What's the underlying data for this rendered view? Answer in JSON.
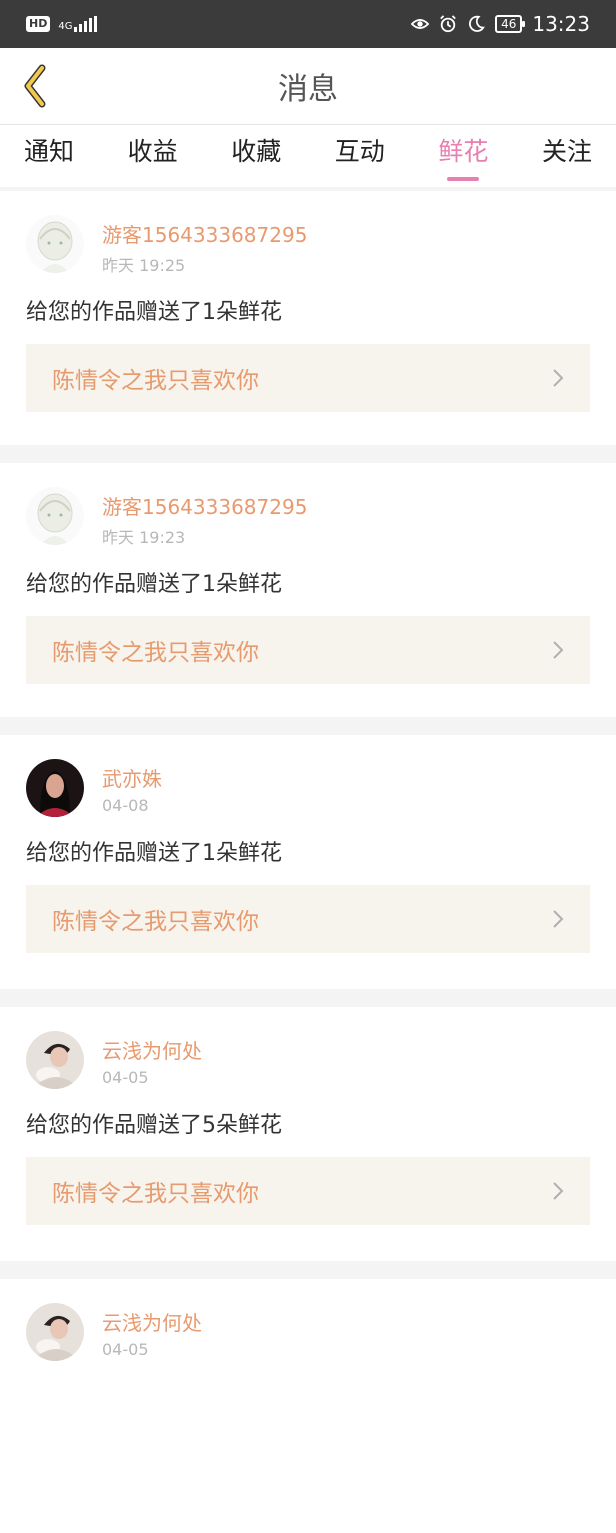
{
  "status_bar": {
    "left_badge": "HD",
    "network": "4G",
    "time": "13:23",
    "battery": "46",
    "icons": [
      "eye-icon",
      "alarm-icon",
      "moon-icon"
    ]
  },
  "header": {
    "title": "消息",
    "back_icon": "chevron-left-icon",
    "back_icon_color": "#f2c94c"
  },
  "tabs": [
    {
      "label": "通知",
      "active": false
    },
    {
      "label": "收益",
      "active": false
    },
    {
      "label": "收藏",
      "active": false
    },
    {
      "label": "互动",
      "active": false
    },
    {
      "label": "鲜花",
      "active": true
    },
    {
      "label": "关注",
      "active": false
    }
  ],
  "colors": {
    "accent_pink": "#e77fb0",
    "username_orange": "#e89a6f",
    "work_box_bg": "#f6f4ec"
  },
  "messages": [
    {
      "username": "游客1564333687295",
      "time": "昨天 19:25",
      "text": "给您的作品赠送了1朵鲜花",
      "work_title": "陈情令之我只喜欢你",
      "avatar": "sketch-avatar"
    },
    {
      "username": "游客1564333687295",
      "time": "昨天 19:23",
      "text": "给您的作品赠送了1朵鲜花",
      "work_title": "陈情令之我只喜欢你",
      "avatar": "sketch-avatar"
    },
    {
      "username": "武亦姝",
      "time": "04-08",
      "text": "给您的作品赠送了1朵鲜花",
      "work_title": "陈情令之我只喜欢你",
      "avatar": "photo-avatar-dark"
    },
    {
      "username": "云浅为何处",
      "time": "04-05",
      "text": "给您的作品赠送了5朵鲜花",
      "work_title": "陈情令之我只喜欢你",
      "avatar": "photo-avatar-light"
    },
    {
      "username": "云浅为何处",
      "time": "04-05",
      "text": "",
      "work_title": "",
      "avatar": "photo-avatar-light"
    }
  ]
}
